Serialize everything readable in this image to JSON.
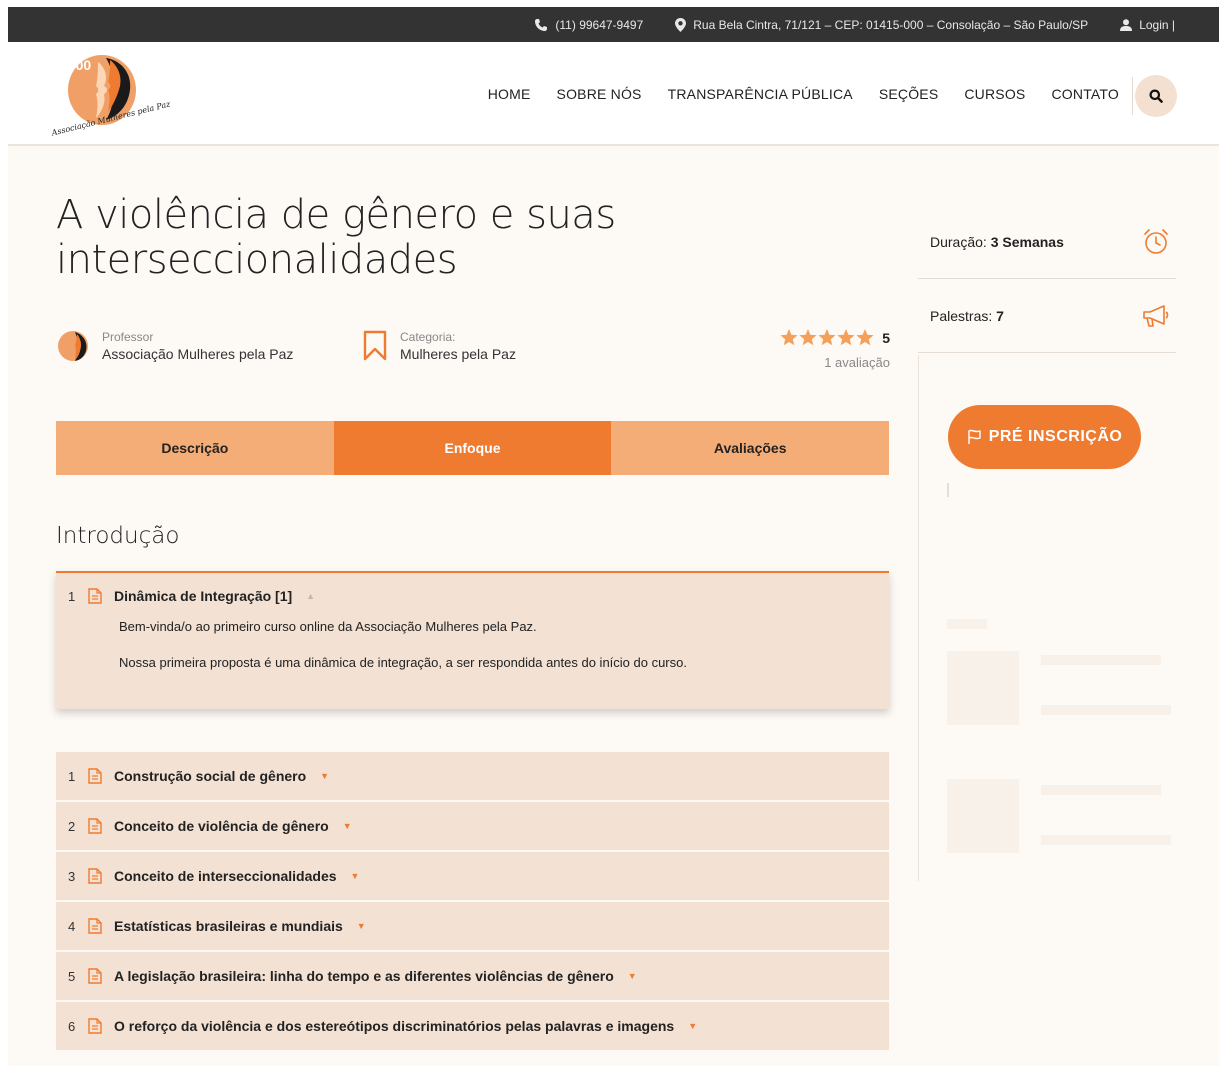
{
  "topbar": {
    "phone": "(11) 99647-9497",
    "address": "Rua Bela Cintra, 71/121 – CEP: 01415-000 – Consolação – São Paulo/SP",
    "login": "Login |"
  },
  "logo": {
    "number": "1000",
    "text": "Associação Mulheres pela Paz"
  },
  "nav": {
    "items": [
      "HOME",
      "SOBRE NÓS",
      "TRANSPARÊNCIA PÚBLICA",
      "SEÇÕES",
      "CURSOS",
      "CONTATO"
    ]
  },
  "course": {
    "title": "A violência de gênero e suas interseccionalidades",
    "teacher_label": "Professor",
    "teacher": "Associação Mulheres pela Paz",
    "category_label": "Categoria:",
    "category": "Mulheres pela Paz",
    "rating_value": "5",
    "rating_count": "1 avaliação",
    "stars": 5
  },
  "tabs": [
    "Descrição",
    "Enfoque",
    "Avaliações"
  ],
  "curriculum": {
    "section_title": "Introdução",
    "open_item": {
      "index": "1",
      "title": "Dinâmica de Integração [1]",
      "paragraphs": [
        "Bem-vinda/o ao primeiro curso online da Associação Mulheres pela Paz.",
        "Nossa primeira proposta é uma dinâmica de integração, a ser respondida antes do início do curso."
      ]
    },
    "items": [
      {
        "index": "1",
        "title": "Construção social de gênero"
      },
      {
        "index": "2",
        "title": "Conceito de violência de gênero"
      },
      {
        "index": "3",
        "title": "Conceito de interseccionalidades"
      },
      {
        "index": "4",
        "title": "Estatísticas brasileiras e mundiais"
      },
      {
        "index": "5",
        "title": "A legislação brasileira: linha do tempo e as diferentes violências de gênero"
      },
      {
        "index": "6",
        "title": "O reforço da violência e dos estereótipos discriminatórios pelas palavras e imagens"
      }
    ]
  },
  "sidebar": {
    "duration_label": "Duração:",
    "duration_value": "3 Semanas",
    "lectures_label": "Palestras:",
    "lectures_value": "7",
    "cta": "PRÉ INSCRIÇÃO"
  },
  "colors": {
    "accent": "#ef7b31",
    "accent_light": "#f4ad76",
    "row_bg": "#f3e1d3",
    "topbar": "#333333"
  }
}
